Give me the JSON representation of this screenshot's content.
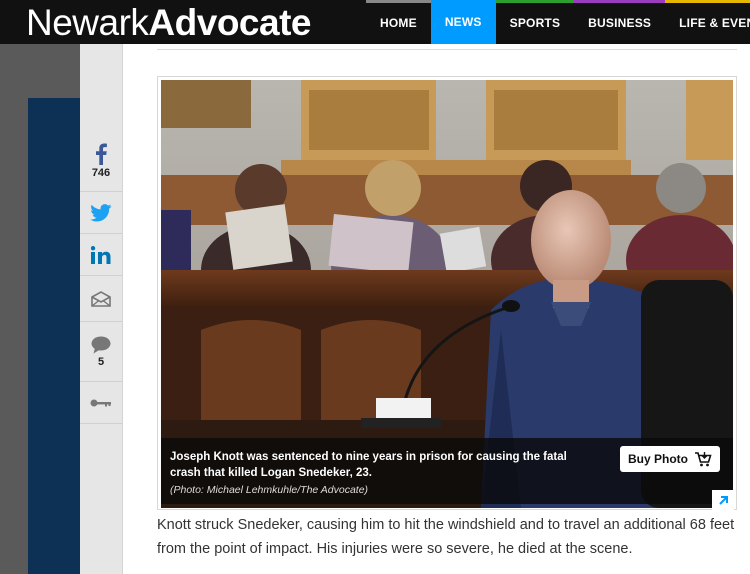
{
  "header": {
    "logo_part1": "Newark",
    "logo_part2": "Advocate",
    "nav": {
      "home": "HOME",
      "news": "NEWS",
      "sports": "SPORTS",
      "business": "BUSINESS",
      "life": "LIFE & EVENTS"
    }
  },
  "share": {
    "facebook_count": "746",
    "comments_count": "5"
  },
  "photo": {
    "caption": "Joseph Knott was sentenced to nine years in prison for causing the fatal crash that killed Logan Snedeker, 23.",
    "credit": "(Photo: Michael Lehmkuhle/The Advocate)",
    "buy_label": "Buy Photo"
  },
  "article": {
    "paragraph": "Knott struck Snedeker, causing him to hit the windshield and to travel an additional 68 feet from the point of impact. His injuries were so severe, he died at the scene."
  },
  "colors": {
    "accent": "#009bff",
    "header_bg": "#111111",
    "left_panel": "#0c3154"
  }
}
